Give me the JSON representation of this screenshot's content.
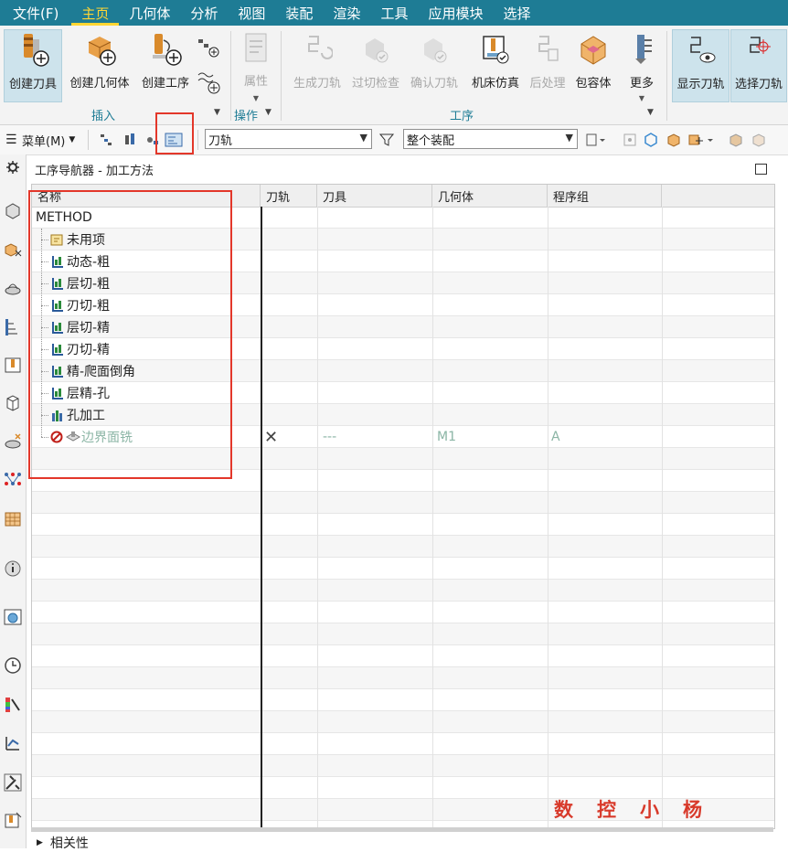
{
  "menubar": {
    "tabs": [
      {
        "label": "文件(F)",
        "kind": "file"
      },
      {
        "label": "主页",
        "active": true
      },
      {
        "label": "几何体"
      },
      {
        "label": "分析"
      },
      {
        "label": "视图"
      },
      {
        "label": "装配"
      },
      {
        "label": "渲染"
      },
      {
        "label": "工具"
      },
      {
        "label": "应用模块"
      },
      {
        "label": "选择"
      }
    ]
  },
  "ribbon": {
    "insert": {
      "group_label": "插入",
      "create_tool": "创建刀具",
      "create_geometry": "创建几何体",
      "create_operation": "创建工序"
    },
    "operation": {
      "group_label": "操作",
      "properties": "属性"
    },
    "process": {
      "group_label": "工序",
      "generate_toolpath": "生成刀轨",
      "gouge_check": "过切检查",
      "verify_toolpath": "确认刀轨",
      "machine_simulation": "机床仿真",
      "postprocess": "后处理",
      "containment": "包容体",
      "more": "更多"
    },
    "display_toolpath": "显示刀轨",
    "select_toolpath": "选择刀轨"
  },
  "toolbar": {
    "menu_label": "菜单(M)",
    "filter_value": "刀轨",
    "scope_value": "整个装配"
  },
  "navigator": {
    "title": "工序导航器 - 加工方法",
    "columns": [
      "名称",
      "刀轨",
      "刀具",
      "几何体",
      "程序组"
    ],
    "rows": [
      {
        "name": "METHOD",
        "kind": "root"
      },
      {
        "name": "未用项",
        "kind": "unused"
      },
      {
        "name": "动态-粗",
        "kind": "method"
      },
      {
        "name": "层切-粗",
        "kind": "method"
      },
      {
        "name": "刃切-粗",
        "kind": "method"
      },
      {
        "name": "层切-精",
        "kind": "method"
      },
      {
        "name": "刃切-精",
        "kind": "method"
      },
      {
        "name": "精-爬面倒角",
        "kind": "method"
      },
      {
        "name": "层精-孔",
        "kind": "method"
      },
      {
        "name": "孔加工",
        "kind": "drill"
      },
      {
        "name": "边界面铣",
        "kind": "operation",
        "toolpath": "✕",
        "tool": "---",
        "geometry": "M1",
        "program": "A"
      }
    ]
  },
  "footer": {
    "related": "相关性"
  },
  "watermark": "数控小杨",
  "colors": {
    "menubar": "#1e7c95",
    "active_tab": "#ffd633",
    "highlight_box": "#e3372a",
    "dim_text": "#8bb5a5"
  }
}
